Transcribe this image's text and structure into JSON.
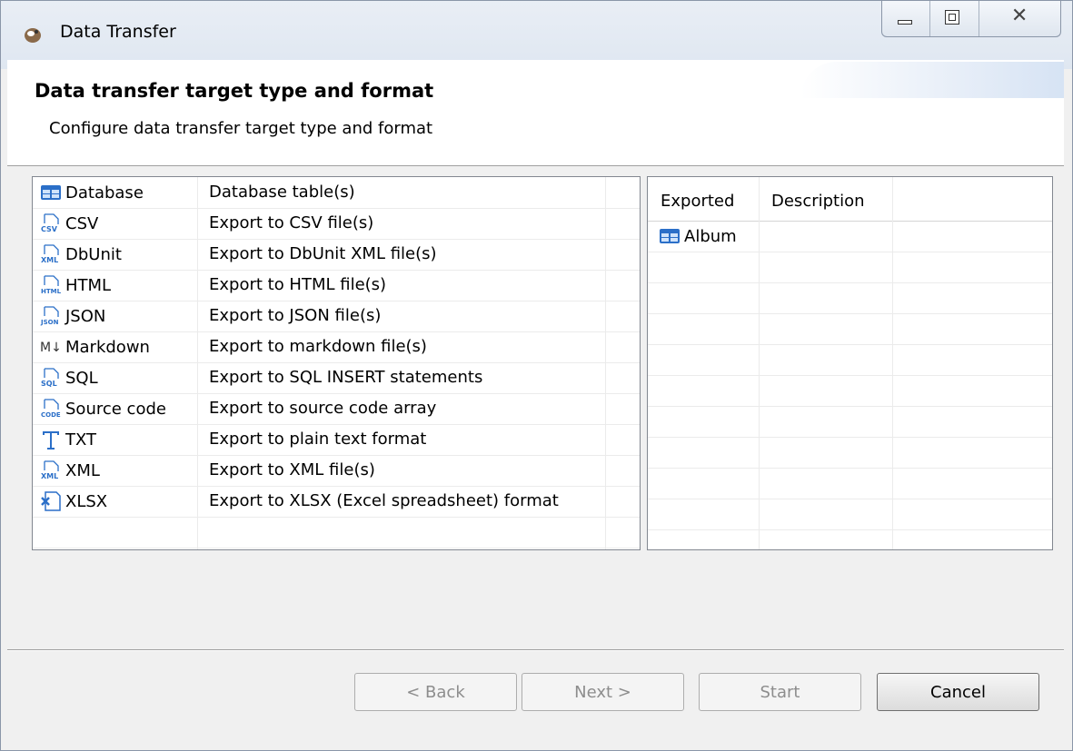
{
  "window": {
    "title": "Data Transfer"
  },
  "header": {
    "title": "Data transfer target type and format",
    "subtitle": "Configure data transfer target type and format"
  },
  "formats": [
    {
      "name": "Database",
      "description": "Database table(s)",
      "icon": "database-table-icon"
    },
    {
      "name": "CSV",
      "description": "Export to CSV file(s)",
      "icon": "csv-file-icon"
    },
    {
      "name": "DbUnit",
      "description": "Export to DbUnit XML file(s)",
      "icon": "xml-file-icon"
    },
    {
      "name": "HTML",
      "description": "Export to HTML file(s)",
      "icon": "html-file-icon"
    },
    {
      "name": "JSON",
      "description": "Export to JSON file(s)",
      "icon": "json-file-icon"
    },
    {
      "name": "Markdown",
      "description": "Export to markdown file(s)",
      "icon": "markdown-icon"
    },
    {
      "name": "SQL",
      "description": "Export to SQL INSERT statements",
      "icon": "sql-file-icon"
    },
    {
      "name": "Source code",
      "description": "Export to source code array",
      "icon": "code-file-icon"
    },
    {
      "name": "TXT",
      "description": "Export to plain text format",
      "icon": "text-icon"
    },
    {
      "name": "XML",
      "description": "Export to XML file(s)",
      "icon": "xml-file-icon"
    },
    {
      "name": "XLSX",
      "description": "Export to XLSX (Excel spreadsheet) format",
      "icon": "excel-icon"
    }
  ],
  "exported_table": {
    "columns": [
      "Exported",
      "Description"
    ],
    "rows": [
      {
        "exported": "Album",
        "description": "",
        "icon": "database-table-icon"
      }
    ]
  },
  "buttons": {
    "back": "< Back",
    "next": "Next >",
    "start": "Start",
    "cancel": "Cancel"
  },
  "colors": {
    "table_icon": "#2b6fc8",
    "header_bg": "#ffffff",
    "dialog_bg": "#f0f0f0"
  }
}
